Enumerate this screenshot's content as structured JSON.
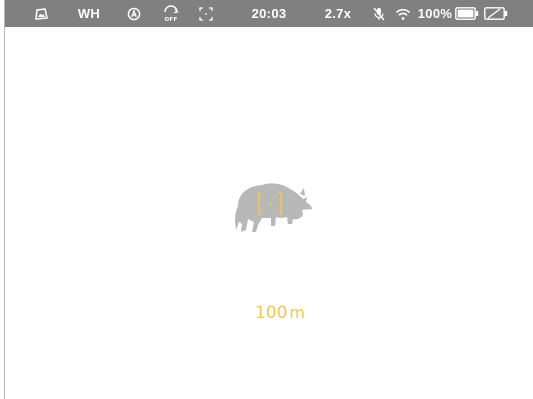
{
  "status_bar": {
    "background": "#808080",
    "items": {
      "mode_icon": "mountain-mode-icon",
      "palette": "WH",
      "auto_calibration_icon": "auto-calibration-icon",
      "stadiametric_icon": "stadiametric-off-icon",
      "stadiametric_label": "OFF",
      "crosshair_icon": "crosshair-icon",
      "time": "20:03",
      "zoom": "2.7x",
      "mic_icon": "microphone-off-icon",
      "wifi_icon": "wifi-icon",
      "battery_percent": "100%",
      "battery_icon": "battery-full-icon",
      "external_power_icon": "external-power-off-icon"
    }
  },
  "center": {
    "target_icon": "boar-silhouette-icon",
    "reticle_icon": "range-reticle-icon",
    "accent_color": "#f2c84b",
    "silhouette_color": "#b8b8b8",
    "distance_value": "100",
    "distance_unit": "m"
  }
}
